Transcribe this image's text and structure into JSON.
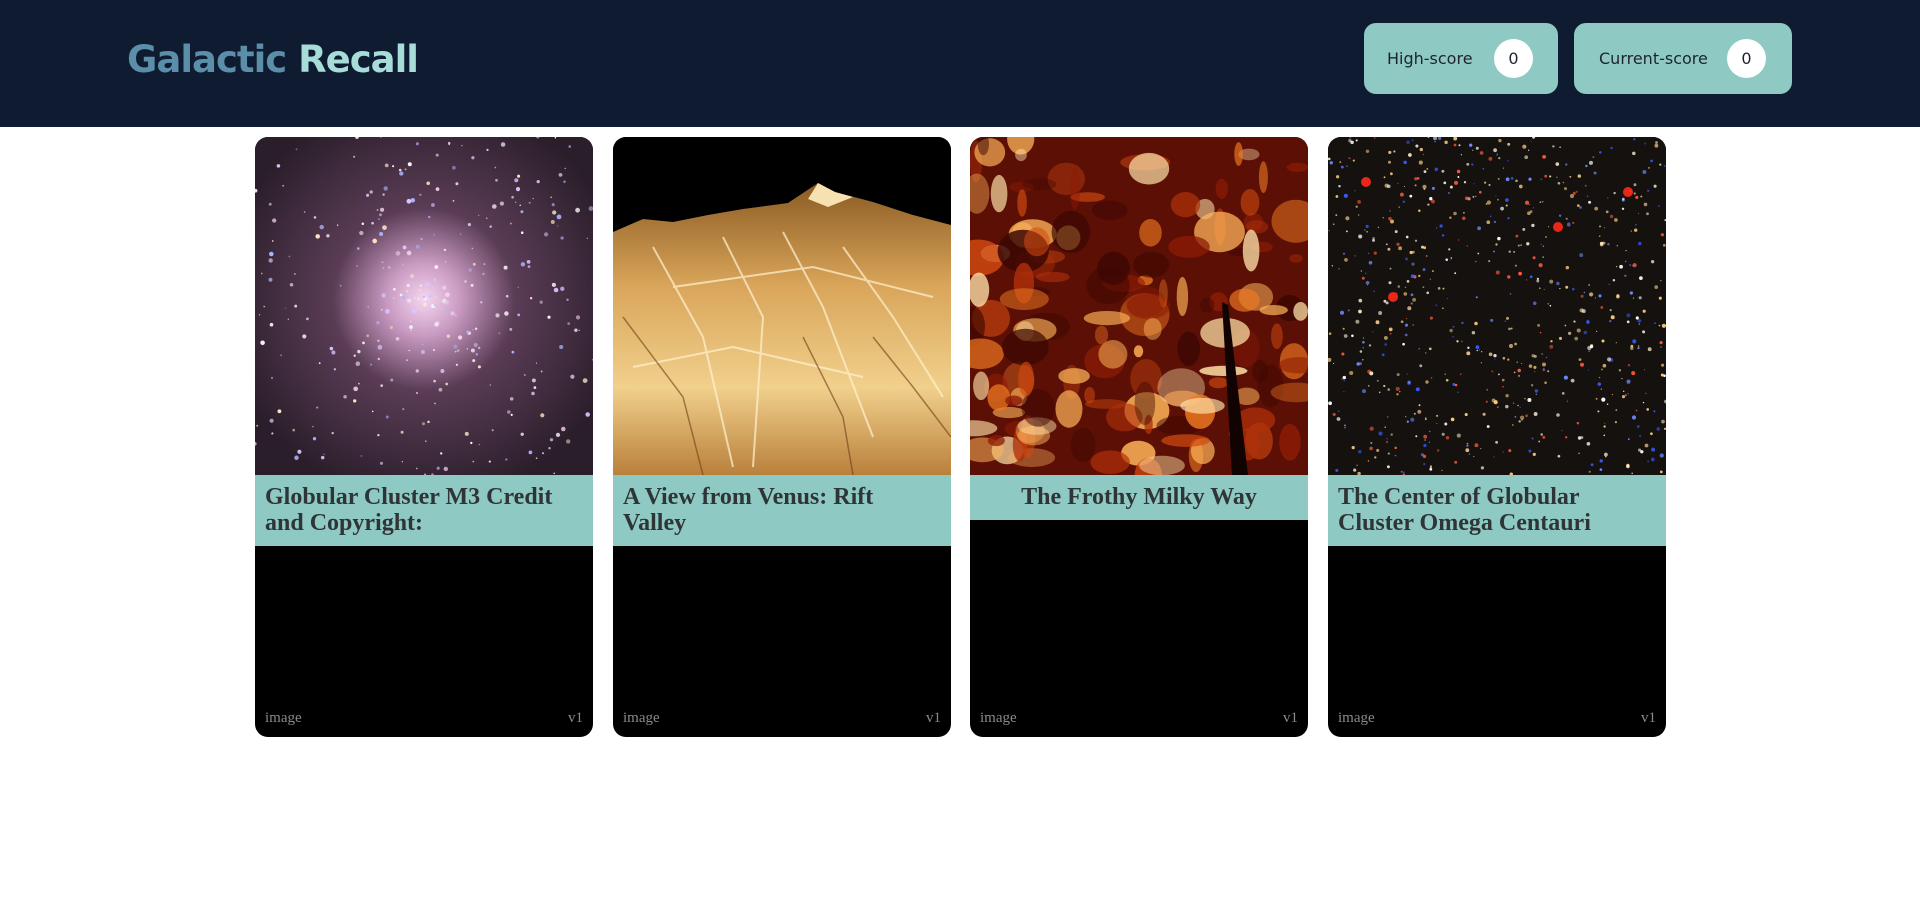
{
  "header": {
    "logo_word1": "Galactic",
    "logo_word2": "Recall",
    "high_score": {
      "label": "High-score",
      "value": "0"
    },
    "current_score": {
      "label": "Current-score",
      "value": "0"
    }
  },
  "cards": [
    {
      "title": "Globular Cluster M3 Credit and Copyright:",
      "type_label": "image",
      "version_label": "v1"
    },
    {
      "title": "A View from Venus: Rift Valley",
      "type_label": "image",
      "version_label": "v1"
    },
    {
      "title": "The Frothy Milky Way",
      "type_label": "image",
      "version_label": "v1"
    },
    {
      "title": "The Center of Globular Cluster Omega Centauri",
      "type_label": "image",
      "version_label": "v1"
    }
  ],
  "colors": {
    "header_bg": "#0f1b31",
    "accent_teal": "#8fc9c3",
    "logo_blue": "#5b8ea8",
    "logo_mint": "#a7dcd8"
  }
}
